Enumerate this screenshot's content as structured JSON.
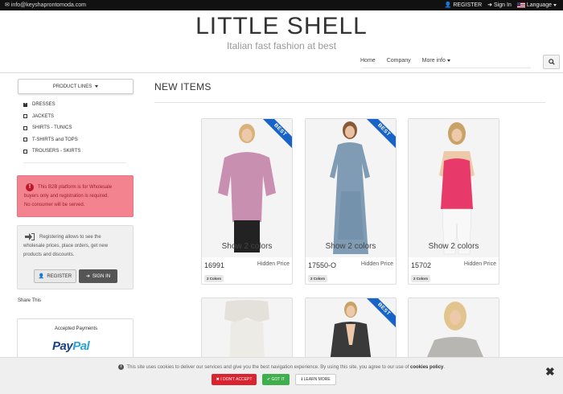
{
  "topbar": {
    "email": "info@keyshaprontomoda.com",
    "register": "REGISTER",
    "sign_in": "Sign In",
    "language": "Language"
  },
  "header": {
    "brand": "LITTLE SHELL",
    "tagline": "Italian fast fashion at best",
    "nav": [
      "Home",
      "Company",
      "More info"
    ]
  },
  "sidebar": {
    "product_lines_label": "PRODUCT LINES",
    "categories": [
      "DRESSES",
      "JACKETS",
      "SHIRTS - TUNICS",
      "T-SHIRTS and TOPS",
      "TROUSERS - SKIRTS"
    ],
    "warning_lines": [
      "This B2B platform is for Wholesale",
      "buyers only and registration is required.",
      "No consumer will be served."
    ],
    "register_lines": [
      "Registering allows to see the",
      "wholesale prices, place orders, get new",
      "products and discounts."
    ],
    "register_button": "REGISTER",
    "signin_button": "SIGN IN",
    "share_this": "Share This",
    "payments_title": "Accepted Payments",
    "paypal_a": "Pay",
    "paypal_b": "Pal"
  },
  "main": {
    "title": "NEW ITEMS",
    "products": [
      {
        "code": "16991",
        "price": "Hidden Price",
        "show": "Show 2 colors",
        "colors": "2 Colors",
        "badge": "BEST"
      },
      {
        "code": "17550-O",
        "price": "Hidden Price",
        "show": "Show 2 colors",
        "colors": "2 Colors",
        "badge": "BEST"
      },
      {
        "code": "15702",
        "price": "Hidden Price",
        "show": "Show 2 colors",
        "colors": "2 Colors",
        "badge": ""
      }
    ],
    "row2_badge": "BEST"
  },
  "cookie": {
    "message": "This site uses cookies to deliver our services and give you the best navigation experience. By using this site, you agree to our use of",
    "policy_link": "cookies policy",
    "dont_accept": "I DON'T ACCEPT",
    "got_it": "GOT IT",
    "learn_more": "LEARN MORE"
  }
}
